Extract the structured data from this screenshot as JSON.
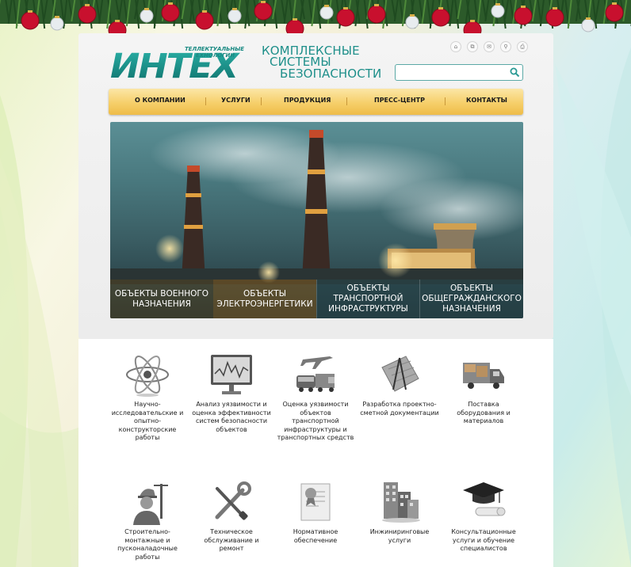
{
  "brand": {
    "logo_text": "ИНТЕХ",
    "logo_subtitle_1": "ТЕЛЛЕКТУАЛЬНЫЕ",
    "logo_subtitle_2": "ЕХНОЛОГИИ",
    "slogan_line1": "КОМПЛЕКСНЫЕ",
    "slogan_line2": "СИСТЕМЫ",
    "slogan_line3": "БЕЗОПАСНОСТИ",
    "accent_color": "#1e8f8a"
  },
  "top_icons": [
    "home-icon",
    "sitemap-icon",
    "mail-icon",
    "search-icon",
    "print-icon"
  ],
  "search": {
    "value": "",
    "placeholder": ""
  },
  "nav": {
    "items": [
      "О КОМПАНИИ",
      "УСЛУГИ",
      "ПРОДУКЦИЯ",
      "ПРЕСС-ЦЕНТР",
      "КОНТАКТЫ"
    ]
  },
  "banner": {
    "tabs": [
      "ОБЪЕКТЫ ВОЕННОГО НАЗНАЧЕНИЯ",
      "ОБЪЕКТЫ ЭЛЕКТРОЭНЕРГЕТИКИ",
      "ОБЪЕКТЫ ТРАНСПОРТНОЙ ИНФРАСТРУКТУРЫ",
      "ОБЪЕКТЫ ОБЩЕГРАЖДАНСКОГО НАЗНАЧЕНИЯ"
    ]
  },
  "services": [
    {
      "label": "Научно-исследовательские и опытно-конструкторские работы",
      "icon": "atom-icon"
    },
    {
      "label": "Анализ уязвимости и оценка эффективности систем безопасности объектов",
      "icon": "monitor-chart-icon"
    },
    {
      "label": "Оценка уязвимости объектов транспортной инфраструктуры и транспортных средств",
      "icon": "transport-icon"
    },
    {
      "label": "Разработка проектно-сметной документации",
      "icon": "blueprint-icon"
    },
    {
      "label": "Поставка оборудования и материалов",
      "icon": "truck-icon"
    },
    {
      "label": "Строительно-монтажные и пусконаладочные работы",
      "icon": "builder-icon"
    },
    {
      "label": "Техническое обслуживание и ремонт",
      "icon": "tools-icon"
    },
    {
      "label": "Нормативное обеспечение",
      "icon": "certificate-icon"
    },
    {
      "label": "Инжиниринговые услуги",
      "icon": "buildings-icon"
    },
    {
      "label": "Консультационные услуги и обучение специалистов",
      "icon": "graduation-icon"
    }
  ]
}
